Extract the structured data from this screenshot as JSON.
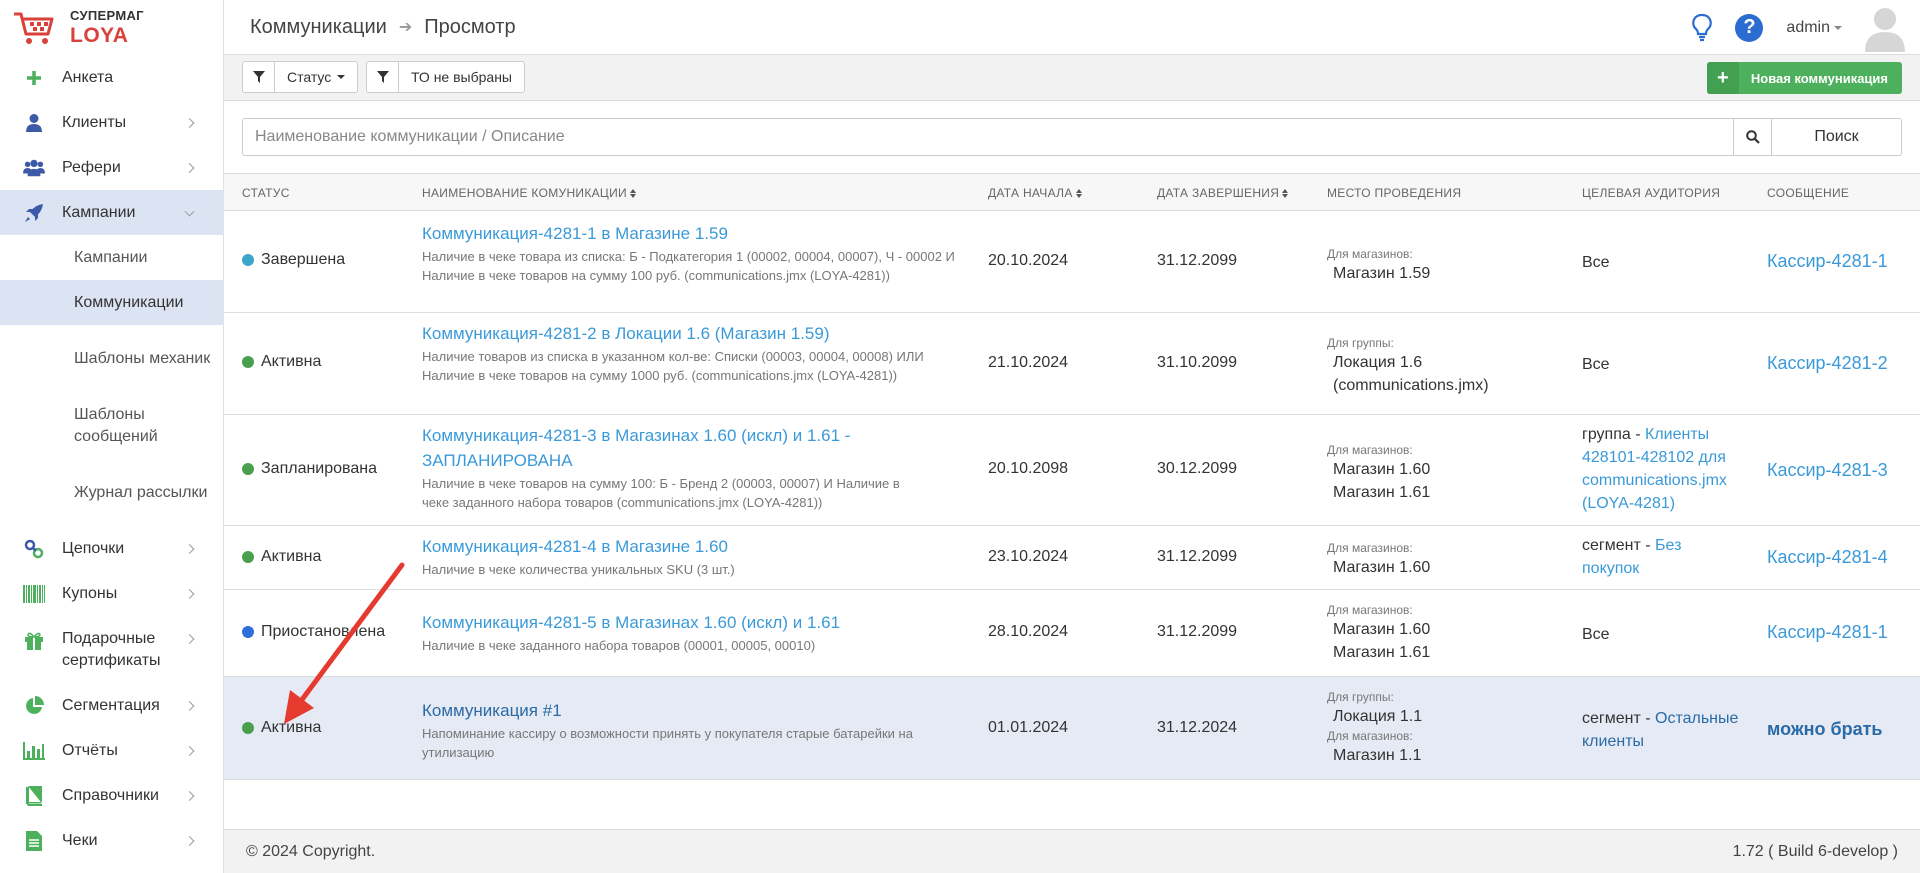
{
  "logo": {
    "line1": "СУПЕРМАГ",
    "line2": "LOYA"
  },
  "sidebar": {
    "items": [
      {
        "label": "Анкета",
        "icon": "plus-icon"
      },
      {
        "label": "Клиенты",
        "icon": "user-icon"
      },
      {
        "label": "Рефери",
        "icon": "users-icon"
      },
      {
        "label": "Кампании",
        "icon": "rocket-icon"
      },
      {
        "label": "Цепочки",
        "icon": "link-icon"
      },
      {
        "label": "Купоны",
        "icon": "barcode-icon"
      },
      {
        "label": "Подарочные сертификаты",
        "icon": "gift-icon"
      },
      {
        "label": "Сегментация",
        "icon": "pie-chart-icon"
      },
      {
        "label": "Отчёты",
        "icon": "bar-chart-icon"
      },
      {
        "label": "Справочники",
        "icon": "book-icon"
      },
      {
        "label": "Чеки",
        "icon": "receipt-icon"
      }
    ],
    "submenu": [
      {
        "label": "Кампании"
      },
      {
        "label": "Коммуникации"
      },
      {
        "label": "Шаблоны механик"
      },
      {
        "label": "Шаблоны сообщений"
      },
      {
        "label": "Журнал рассылки"
      }
    ]
  },
  "topbar": {
    "crumb1": "Коммуникации",
    "crumb2": "Просмотр",
    "user": "admin"
  },
  "toolbar": {
    "filter_status": "Статус",
    "filter_to": "ТО не выбраны",
    "new_button": "Новая коммуникация"
  },
  "search": {
    "placeholder": "Наименование коммуникации / Описание",
    "button": "Поиск"
  },
  "table": {
    "headers": {
      "status": "СТАТУС",
      "name": "НАИМЕНОВАНИЕ КОМУНИКАЦИИ",
      "start": "ДАТА НАЧАЛА",
      "end": "ДАТА ЗАВЕРШЕНИЯ",
      "place": "МЕСТО ПРОВЕДЕНИЯ",
      "audience": "ЦЕЛЕВАЯ АУДИТОРИЯ",
      "message": "СООБЩЕНИЕ"
    },
    "rows": [
      {
        "status": "Завершена",
        "status_color": "#3aa6c9",
        "title": "Коммуникация-4281-1 в Магазине 1.59",
        "desc": "Наличие в чеке товара из списка: Б - Подкатегория 1 (00002, 00004, 00007), Ч - 00002 И Наличие в чеке товаров на сумму 100 руб. (communications.jmx (LOYA-4281))",
        "start": "20.10.2024",
        "end": "31.12.2099",
        "place_label1": "Для магазинов:",
        "place_val1": "Магазин 1.59",
        "audience": "Все",
        "message": "Кассир-4281-1"
      },
      {
        "status": "Активна",
        "status_color": "#4a9e4c",
        "title": "Коммуникация-4281-2 в Локации 1.6 (Магазин 1.59)",
        "desc": "Наличие товаров из списка в указанном кол-ве: Списки (00003, 00004, 00008) ИЛИ Наличие в чеке товаров на сумму 1000 руб. (communications.jmx (LOYA-4281))",
        "start": "21.10.2024",
        "end": "31.10.2099",
        "place_label1": "Для группы:",
        "place_val1": "Локация 1.6 (communications.jmx)",
        "audience": "Все",
        "message": "Кассир-4281-2"
      },
      {
        "status": "Запланирована",
        "status_color": "#4a9e4c",
        "title": "Коммуникация-4281-3 в Магазинах 1.60 (искл) и 1.61 - ЗАПЛАНИРОВАНА",
        "desc": "Наличие в чеке товаров на сумму 100: Б - Бренд 2 (00003, 00007) И Наличие в чеке заданного набора товаров (communications.jmx (LOYA-4281))",
        "start": "20.10.2098",
        "end": "30.12.2099",
        "place_label1": "Для магазинов:",
        "place_val1": "Магазин 1.60",
        "place_val2": "Магазин 1.61",
        "audience_prefix": "группа - ",
        "audience_link": "Клиенты 428101-428102 для communications.jmx (LOYA-4281)",
        "message": "Кассир-4281-3"
      },
      {
        "status": "Активна",
        "status_color": "#4a9e4c",
        "title": "Коммуникация-4281-4 в Магазине 1.60",
        "desc": "Наличие в чеке количества уникальных SKU (3 шт.)",
        "start": "23.10.2024",
        "end": "31.12.2099",
        "place_label1": "Для магазинов:",
        "place_val1": "Магазин 1.60",
        "audience_prefix": "сегмент - ",
        "audience_link": "Без покупок",
        "message": "Кассир-4281-4"
      },
      {
        "status": "Приостановлена",
        "status_color": "#2f6fdb",
        "title": "Коммуникация-4281-5 в Магазинах 1.60 (искл) и 1.61",
        "desc": "Наличие в чеке заданного набора товаров (00001, 00005, 00010)",
        "start": "28.10.2024",
        "end": "31.12.2099",
        "place_label1": "Для магазинов:",
        "place_val1": "Магазин 1.60",
        "place_val2": "Магазин 1.61",
        "audience": "Все",
        "message": "Кассир-4281-1"
      },
      {
        "status": "Активна",
        "status_color": "#4a9e4c",
        "title": "Коммуникация #1",
        "desc": "Напоминание кассиру о возможности принять у покупателя старые батарейки на утилизацию",
        "start": "01.01.2024",
        "end": "31.12.2024",
        "place_label1": "Для группы:",
        "place_val1": "Локация 1.1",
        "place_label2": "Для магазинов:",
        "place_val2": "Магазин 1.1",
        "audience_prefix": "сегмент - ",
        "audience_link": "Остальные клиенты",
        "message": "можно брать"
      }
    ]
  },
  "footer": {
    "copyright": "© 2024 Copyright.",
    "version": "1.72 ( Build 6-develop )"
  },
  "colors": {
    "accent_green": "#4cb05c",
    "link_blue": "#3a9ad9",
    "active_bg": "#dce3f2",
    "arrow_red": "#e53b2f"
  }
}
